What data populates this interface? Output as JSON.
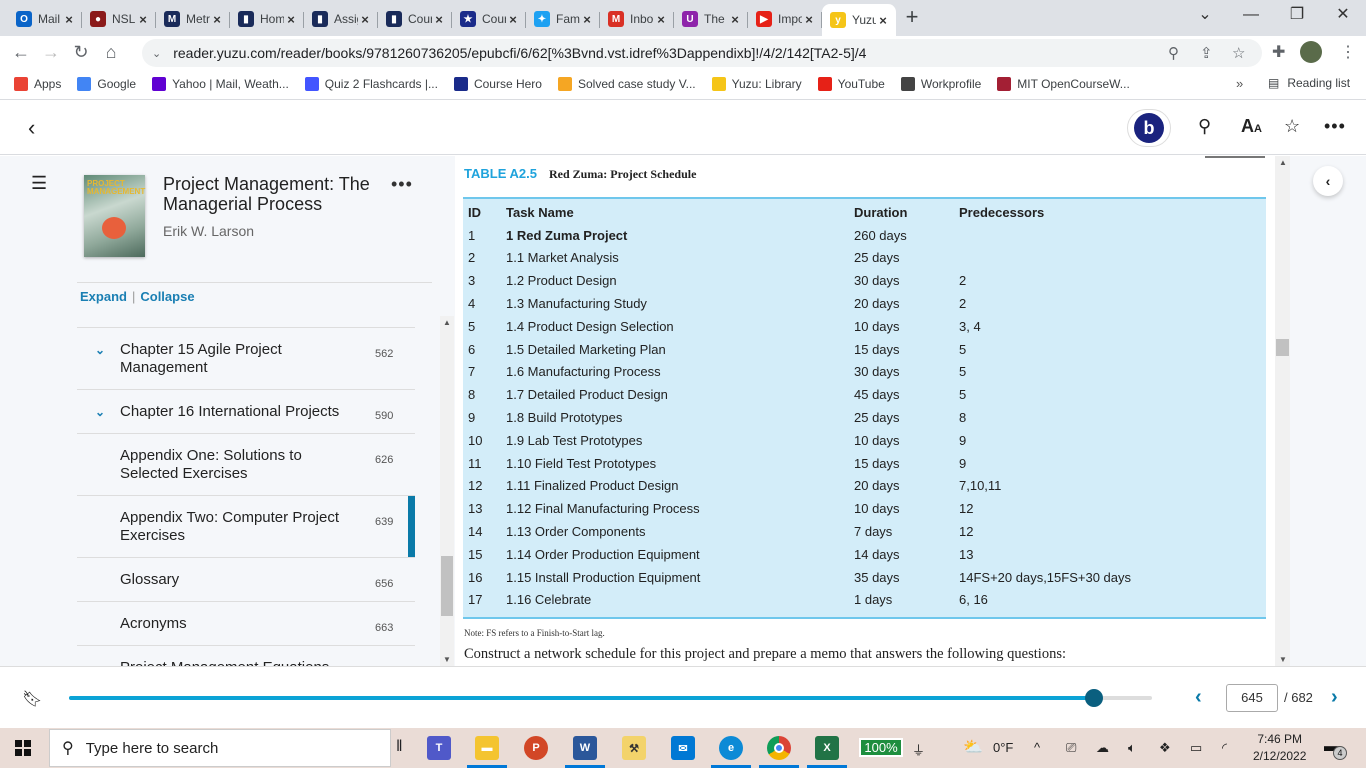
{
  "browser": {
    "tabs": [
      {
        "label": "Mail",
        "icon": "outlook-icon",
        "color": "#0a64c8",
        "glyph": "O"
      },
      {
        "label": "NSLS",
        "icon": "nsls-icon",
        "color": "#8b1a1a",
        "glyph": "●"
      },
      {
        "label": "Metr",
        "icon": "metro-icon",
        "color": "#1a2b5a",
        "glyph": "M"
      },
      {
        "label": "Hom",
        "icon": "course-icon",
        "color": "#1a2b5a",
        "glyph": "▮"
      },
      {
        "label": "Assig",
        "icon": "course-icon",
        "color": "#1a2b5a",
        "glyph": "▮"
      },
      {
        "label": "Cour",
        "icon": "course-icon",
        "color": "#1a2b5a",
        "glyph": "▮"
      },
      {
        "label": "Cour",
        "icon": "coursehero-icon",
        "color": "#1a2b8a",
        "glyph": "★"
      },
      {
        "label": "Famil",
        "icon": "twitter-icon",
        "color": "#1da1f2",
        "glyph": "✦"
      },
      {
        "label": "Inbo",
        "icon": "gmail-icon",
        "color": "#d93025",
        "glyph": "M"
      },
      {
        "label": "The (",
        "icon": "podcast-icon",
        "color": "#8e24aa",
        "glyph": "U"
      },
      {
        "label": "Impo",
        "icon": "youtube-icon",
        "color": "#e62117",
        "glyph": "▶"
      },
      {
        "label": "Yuzu",
        "icon": "yuzu-icon",
        "color": "#f5c518",
        "glyph": "y",
        "active": true
      }
    ],
    "new_tab": "+",
    "url": "reader.yuzu.com/reader/books/9781260736205/epubcfi/6/62[%3Bvnd.vst.idref%3Dappendixb]!/4/2/142[TA2-5]/4",
    "bookmarks": [
      {
        "label": "Apps",
        "icon": "apps-icon"
      },
      {
        "label": "Google",
        "icon": "google-icon"
      },
      {
        "label": "Yahoo | Mail, Weath...",
        "icon": "yahoo-icon"
      },
      {
        "label": "Quiz 2 Flashcards |...",
        "icon": "quizlet-icon"
      },
      {
        "label": "Course Hero",
        "icon": "coursehero-icon"
      },
      {
        "label": "Solved case study V...",
        "icon": "chegg-icon"
      },
      {
        "label": "Yuzu: Library",
        "icon": "yuzu-icon"
      },
      {
        "label": "YouTube",
        "icon": "youtube-icon"
      },
      {
        "label": "Workprofile",
        "icon": "globe-icon"
      },
      {
        "label": "MIT OpenCourseW...",
        "icon": "mit-icon"
      }
    ],
    "bookmarks_more": "»",
    "reading_list": "Reading list"
  },
  "reader": {
    "avatar_letter": "b",
    "book": {
      "title": "Project Management: The Managerial Process",
      "author": "Erik W. Larson",
      "cover_text": "PROJECT MANAGEMENT"
    },
    "expand": "Expand",
    "collapse": "Collapse",
    "toc": [
      {
        "label": "Chapter 15 Agile Project Management",
        "page": "562",
        "expandable": true
      },
      {
        "label": "Chapter 16 International Projects",
        "page": "590",
        "expandable": true
      },
      {
        "label": "Appendix One: Solutions to Selected Exercises",
        "page": "626",
        "expandable": false
      },
      {
        "label": "Appendix Two: Computer Project Exercises",
        "page": "639",
        "expandable": false,
        "active": true
      },
      {
        "label": "Glossary",
        "page": "656",
        "expandable": false
      },
      {
        "label": "Acronyms",
        "page": "663",
        "expandable": false
      },
      {
        "label": "Project Management Equations",
        "page": "",
        "expandable": false
      }
    ],
    "table": {
      "number": "TABLE A2.5",
      "caption": "Red Zuma: Project Schedule",
      "headers": [
        "ID",
        "Task Name",
        "Duration",
        "Predecessors"
      ],
      "rows": [
        [
          "1",
          "1 Red Zuma Project",
          "260 days",
          ""
        ],
        [
          "2",
          "1.1 Market Analysis",
          "25 days",
          ""
        ],
        [
          "3",
          "1.2 Product Design",
          "30 days",
          "2"
        ],
        [
          "4",
          "1.3 Manufacturing Study",
          "20 days",
          "2"
        ],
        [
          "5",
          "1.4 Product Design Selection",
          "10 days",
          "3, 4"
        ],
        [
          "6",
          "1.5 Detailed Marketing Plan",
          "15 days",
          "5"
        ],
        [
          "7",
          "1.6 Manufacturing Process",
          "30 days",
          "5"
        ],
        [
          "8",
          "1.7 Detailed Product Design",
          "45 days",
          "5"
        ],
        [
          "9",
          "1.8 Build Prototypes",
          "25 days",
          "8"
        ],
        [
          "10",
          "1.9 Lab Test Prototypes",
          "10 days",
          "9"
        ],
        [
          "11",
          "1.10 Field Test Prototypes",
          "15 days",
          "9"
        ],
        [
          "12",
          "1.11 Finalized Product Design",
          "20 days",
          "7,10,11"
        ],
        [
          "13",
          "1.12 Final Manufacturing Process",
          "10 days",
          "12"
        ],
        [
          "14",
          "1.13 Order Components",
          "7 days",
          "12"
        ],
        [
          "15",
          "1.14 Order Production Equipment",
          "14 days",
          "13"
        ],
        [
          "16",
          "1.15 Install Production Equipment",
          "35 days",
          "14FS+20 days,15FS+30 days"
        ],
        [
          "17",
          "1.16 Celebrate",
          "1 days",
          "6, 16"
        ]
      ]
    },
    "note": "Note: FS refers to a Finish-to-Start lag.",
    "paragraph": "Construct a network schedule for this project and prepare a memo that answers the following questions:",
    "pager": {
      "current": "645",
      "total": "/ 682",
      "progress_fraction": 0.946
    }
  },
  "taskbar": {
    "search_placeholder": "Type here to search",
    "battery_label": "100%",
    "weather": "0°F",
    "time": "7:46 PM",
    "date": "2/12/2022",
    "notification_count": "4"
  }
}
